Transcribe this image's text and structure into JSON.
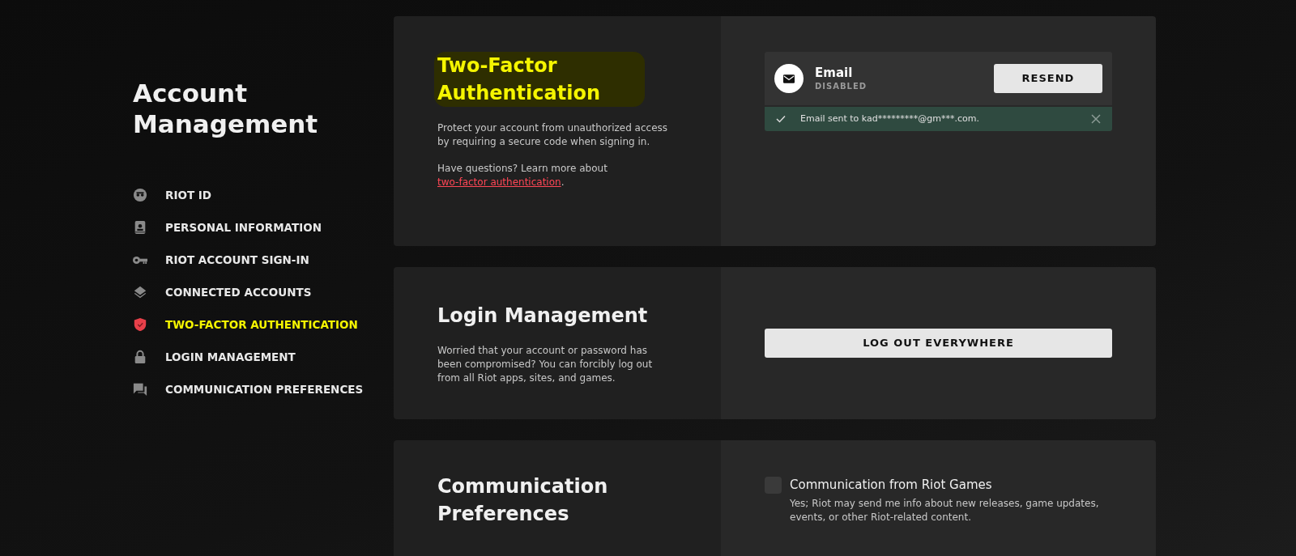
{
  "sidebar": {
    "title": "Account Management",
    "items": [
      {
        "label": "RIOT ID",
        "selected": false
      },
      {
        "label": "PERSONAL INFORMATION",
        "selected": false
      },
      {
        "label": "RIOT ACCOUNT SIGN-IN",
        "selected": false
      },
      {
        "label": "CONNECTED ACCOUNTS",
        "selected": false
      },
      {
        "label": "TWO-FACTOR AUTHENTICATION",
        "selected": true
      },
      {
        "label": "LOGIN MANAGEMENT",
        "selected": false
      },
      {
        "label": "COMMUNICATION PREFERENCES",
        "selected": false
      }
    ]
  },
  "sections": [
    {
      "kind": "two_factor",
      "title": "Two-Factor Authentication",
      "highlighted": true,
      "description": "Protect your account from unauthorized access by requiring a secure code when signing in.",
      "help": {
        "text": "Have questions? Learn more about",
        "link": "two-factor authentication",
        "after": "."
      },
      "method": {
        "label": "Email",
        "status": "DISABLED",
        "button": "RESEND"
      },
      "notice": {
        "text": "Email sent to kad*********@gm***.com."
      }
    },
    {
      "kind": "login",
      "title": "Login Management",
      "highlighted": false,
      "description": "Worried that your account or password has been compromised? You can forcibly log out from all Riot apps, sites, and games.",
      "button": "LOG OUT EVERYWHERE"
    },
    {
      "kind": "communication",
      "title": "Communication Preferences",
      "highlighted": false,
      "option": {
        "label": "Communication from Riot Games",
        "description": "Yes; Riot may send me info about new releases, game updates, events, or other Riot-related content.",
        "checked": false
      }
    }
  ]
}
